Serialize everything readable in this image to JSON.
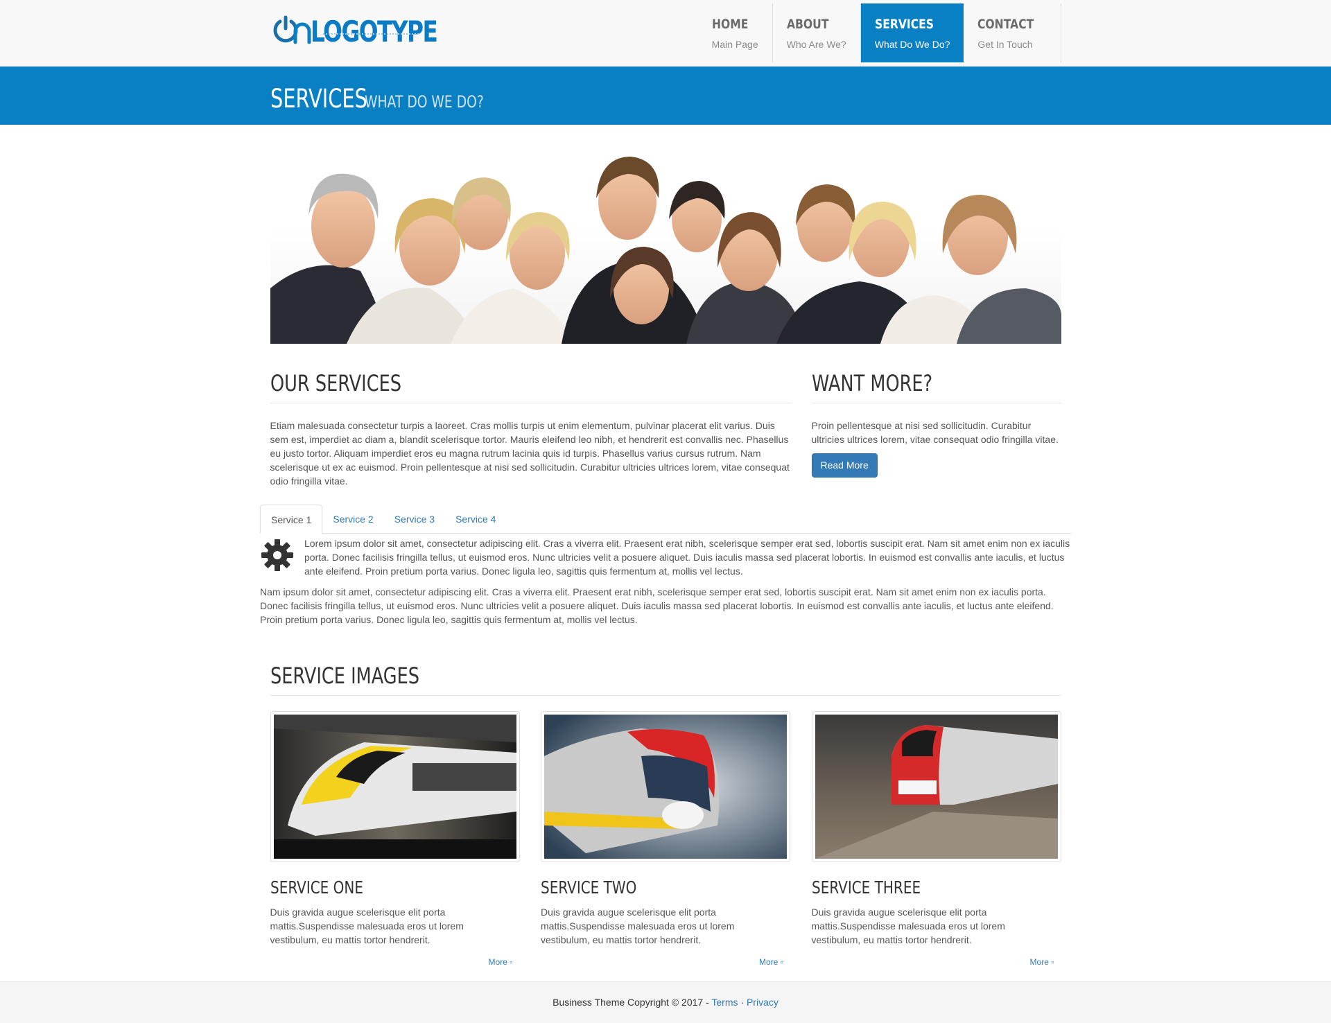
{
  "header": {
    "logo_text": "LOGOTYPE",
    "nav": [
      {
        "title": "HOME",
        "sub": "Main Page"
      },
      {
        "title": "ABOUT",
        "sub": "Who Are We?"
      },
      {
        "title": "SERVICES",
        "sub": "What Do We Do?",
        "active": true
      },
      {
        "title": "CONTACT",
        "sub": "Get In Touch"
      }
    ]
  },
  "banner": {
    "title": "SERVICES",
    "subtitle": "WHAT DO WE DO?"
  },
  "our_services": {
    "heading": "OUR SERVICES",
    "text": "Etiam malesuada consectetur turpis a laoreet. Cras mollis turpis ut enim elementum, pulvinar placerat elit varius. Duis sem est, imperdiet ac diam a, blandit scelerisque tortor. Mauris eleifend leo nibh, et hendrerit est convallis nec. Phasellus eu justo tortor. Aliquam imperdiet eros eu magna rutrum lacinia quis id turpis. Phasellus varius cursus rutrum. Nam scelerisque ut ex ac euismod. Proin pellentesque at nisi sed sollicitudin. Curabitur ultricies ultrices lorem, vitae consequat odio fringilla vitae."
  },
  "want_more": {
    "heading": "WANT MORE?",
    "text": "Proin pellentesque at nisi sed sollicitudin. Curabitur ultricies ultrices lorem, vitae consequat odio fringilla vitae.",
    "button": "Read More"
  },
  "tabs": {
    "labels": [
      "Service 1",
      "Service 2",
      "Service 3",
      "Service 4"
    ],
    "active": "Service 1",
    "icon": "gear-icon",
    "p1": "Lorem ipsum dolor sit amet, consectetur adipiscing elit. Cras a viverra elit. Praesent erat nibh, scelerisque semper erat sed, lobortis suscipit erat. Nam sit amet enim non ex iaculis porta. Donec facilisis fringilla tellus, ut euismod eros. Nunc ultricies velit a posuere aliquet. Duis iaculis massa sed placerat lobortis. In euismod est convallis ante iaculis, et luctus ante eleifend. Proin pretium porta varius. Donec ligula leo, sagittis quis fermentum at, mollis vel lectus.",
    "p2": "Nam ipsum dolor sit amet, consectetur adipiscing elit. Cras a viverra elit. Praesent erat nibh, scelerisque semper erat sed, lobortis suscipit erat. Nam sit amet enim non ex iaculis porta. Donec facilisis fringilla tellus, ut euismod eros. Nunc ultricies velit a posuere aliquet. Duis iaculis massa sed placerat lobortis. In euismod est convallis ante iaculis, et luctus ante eleifend. Proin pretium porta varius. Donec ligula leo, sagittis quis fermentum at, mollis vel lectus."
  },
  "service_images": {
    "heading": "SERVICE IMAGES",
    "cards": [
      {
        "title": "SERVICE ONE",
        "text": "Duis gravida augue scelerisque elit porta mattis.Suspendisse malesuada eros ut lorem vestibulum, eu mattis tortor hendrerit.",
        "more": "More"
      },
      {
        "title": "SERVICE TWO",
        "text": "Duis gravida augue scelerisque elit porta mattis.Suspendisse malesuada eros ut lorem vestibulum, eu mattis tortor hendrerit.",
        "more": "More"
      },
      {
        "title": "SERVICE THREE",
        "text": "Duis gravida augue scelerisque elit porta mattis.Suspendisse malesuada eros ut lorem vestibulum, eu mattis tortor hendrerit.",
        "more": "More"
      }
    ]
  },
  "footer": {
    "copyright": "Business Theme Copyright © 2017 -",
    "terms": "Terms",
    "separator": "·",
    "privacy": "Privacy"
  },
  "colors": {
    "brand_blue": "#0a80c4",
    "link_blue": "#337ab7"
  }
}
